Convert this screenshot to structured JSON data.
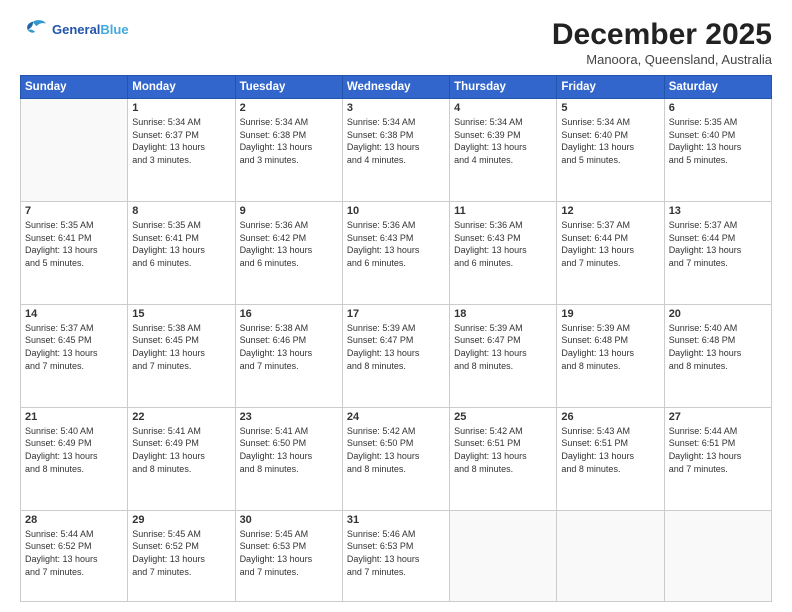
{
  "header": {
    "logo_line1": "General",
    "logo_line2": "Blue",
    "month": "December 2025",
    "location": "Manoora, Queensland, Australia"
  },
  "weekdays": [
    "Sunday",
    "Monday",
    "Tuesday",
    "Wednesday",
    "Thursday",
    "Friday",
    "Saturday"
  ],
  "weeks": [
    [
      {
        "day": "",
        "info": ""
      },
      {
        "day": "1",
        "info": "Sunrise: 5:34 AM\nSunset: 6:37 PM\nDaylight: 13 hours\nand 3 minutes."
      },
      {
        "day": "2",
        "info": "Sunrise: 5:34 AM\nSunset: 6:38 PM\nDaylight: 13 hours\nand 3 minutes."
      },
      {
        "day": "3",
        "info": "Sunrise: 5:34 AM\nSunset: 6:38 PM\nDaylight: 13 hours\nand 4 minutes."
      },
      {
        "day": "4",
        "info": "Sunrise: 5:34 AM\nSunset: 6:39 PM\nDaylight: 13 hours\nand 4 minutes."
      },
      {
        "day": "5",
        "info": "Sunrise: 5:34 AM\nSunset: 6:40 PM\nDaylight: 13 hours\nand 5 minutes."
      },
      {
        "day": "6",
        "info": "Sunrise: 5:35 AM\nSunset: 6:40 PM\nDaylight: 13 hours\nand 5 minutes."
      }
    ],
    [
      {
        "day": "7",
        "info": "Sunrise: 5:35 AM\nSunset: 6:41 PM\nDaylight: 13 hours\nand 5 minutes."
      },
      {
        "day": "8",
        "info": "Sunrise: 5:35 AM\nSunset: 6:41 PM\nDaylight: 13 hours\nand 6 minutes."
      },
      {
        "day": "9",
        "info": "Sunrise: 5:36 AM\nSunset: 6:42 PM\nDaylight: 13 hours\nand 6 minutes."
      },
      {
        "day": "10",
        "info": "Sunrise: 5:36 AM\nSunset: 6:43 PM\nDaylight: 13 hours\nand 6 minutes."
      },
      {
        "day": "11",
        "info": "Sunrise: 5:36 AM\nSunset: 6:43 PM\nDaylight: 13 hours\nand 6 minutes."
      },
      {
        "day": "12",
        "info": "Sunrise: 5:37 AM\nSunset: 6:44 PM\nDaylight: 13 hours\nand 7 minutes."
      },
      {
        "day": "13",
        "info": "Sunrise: 5:37 AM\nSunset: 6:44 PM\nDaylight: 13 hours\nand 7 minutes."
      }
    ],
    [
      {
        "day": "14",
        "info": "Sunrise: 5:37 AM\nSunset: 6:45 PM\nDaylight: 13 hours\nand 7 minutes."
      },
      {
        "day": "15",
        "info": "Sunrise: 5:38 AM\nSunset: 6:45 PM\nDaylight: 13 hours\nand 7 minutes."
      },
      {
        "day": "16",
        "info": "Sunrise: 5:38 AM\nSunset: 6:46 PM\nDaylight: 13 hours\nand 7 minutes."
      },
      {
        "day": "17",
        "info": "Sunrise: 5:39 AM\nSunset: 6:47 PM\nDaylight: 13 hours\nand 8 minutes."
      },
      {
        "day": "18",
        "info": "Sunrise: 5:39 AM\nSunset: 6:47 PM\nDaylight: 13 hours\nand 8 minutes."
      },
      {
        "day": "19",
        "info": "Sunrise: 5:39 AM\nSunset: 6:48 PM\nDaylight: 13 hours\nand 8 minutes."
      },
      {
        "day": "20",
        "info": "Sunrise: 5:40 AM\nSunset: 6:48 PM\nDaylight: 13 hours\nand 8 minutes."
      }
    ],
    [
      {
        "day": "21",
        "info": "Sunrise: 5:40 AM\nSunset: 6:49 PM\nDaylight: 13 hours\nand 8 minutes."
      },
      {
        "day": "22",
        "info": "Sunrise: 5:41 AM\nSunset: 6:49 PM\nDaylight: 13 hours\nand 8 minutes."
      },
      {
        "day": "23",
        "info": "Sunrise: 5:41 AM\nSunset: 6:50 PM\nDaylight: 13 hours\nand 8 minutes."
      },
      {
        "day": "24",
        "info": "Sunrise: 5:42 AM\nSunset: 6:50 PM\nDaylight: 13 hours\nand 8 minutes."
      },
      {
        "day": "25",
        "info": "Sunrise: 5:42 AM\nSunset: 6:51 PM\nDaylight: 13 hours\nand 8 minutes."
      },
      {
        "day": "26",
        "info": "Sunrise: 5:43 AM\nSunset: 6:51 PM\nDaylight: 13 hours\nand 8 minutes."
      },
      {
        "day": "27",
        "info": "Sunrise: 5:44 AM\nSunset: 6:51 PM\nDaylight: 13 hours\nand 7 minutes."
      }
    ],
    [
      {
        "day": "28",
        "info": "Sunrise: 5:44 AM\nSunset: 6:52 PM\nDaylight: 13 hours\nand 7 minutes."
      },
      {
        "day": "29",
        "info": "Sunrise: 5:45 AM\nSunset: 6:52 PM\nDaylight: 13 hours\nand 7 minutes."
      },
      {
        "day": "30",
        "info": "Sunrise: 5:45 AM\nSunset: 6:53 PM\nDaylight: 13 hours\nand 7 minutes."
      },
      {
        "day": "31",
        "info": "Sunrise: 5:46 AM\nSunset: 6:53 PM\nDaylight: 13 hours\nand 7 minutes."
      },
      {
        "day": "",
        "info": ""
      },
      {
        "day": "",
        "info": ""
      },
      {
        "day": "",
        "info": ""
      }
    ]
  ]
}
